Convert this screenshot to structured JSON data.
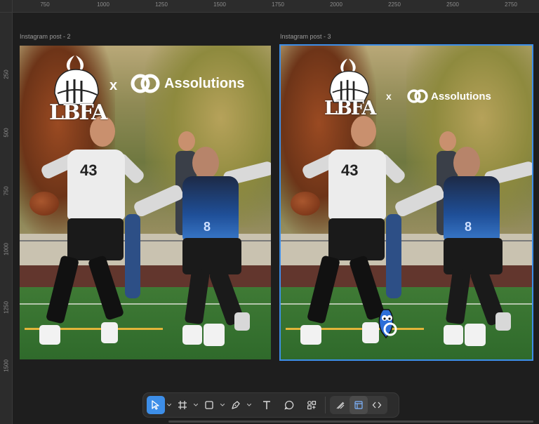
{
  "ruler": {
    "top_ticks": [
      "750",
      "1000",
      "1250",
      "1500",
      "1750",
      "2000",
      "2250",
      "2500",
      "2750"
    ],
    "left_ticks": [
      "250",
      "500",
      "750",
      "1000",
      "1250",
      "1500"
    ]
  },
  "frames": [
    {
      "label": "Instagram post - 2",
      "jersey_number": "43",
      "back_number": "8",
      "logo_text": "LBFA",
      "x_mark": "x",
      "brand": "Assolutions",
      "selected": false
    },
    {
      "label": "Instagram post - 3",
      "jersey_number": "43",
      "back_number": "8",
      "logo_text": "LBFA",
      "x_mark": "x",
      "brand": "Assolutions",
      "selected": true
    }
  ],
  "toolbar": {
    "tools": [
      {
        "name": "move-tool",
        "icon": "cursor-arrow-icon",
        "active": true,
        "has_caret": true
      },
      {
        "name": "frame-tool",
        "icon": "frame-hash-icon",
        "active": false,
        "has_caret": true
      },
      {
        "name": "shape-tool",
        "icon": "rectangle-icon",
        "active": false,
        "has_caret": true
      },
      {
        "name": "pen-tool",
        "icon": "pen-icon",
        "active": false,
        "has_caret": true
      },
      {
        "name": "text-tool",
        "icon": "text-icon",
        "active": false,
        "has_caret": false
      },
      {
        "name": "comment-tool",
        "icon": "comment-bubble-icon",
        "active": false,
        "has_caret": false
      },
      {
        "name": "actions-tool",
        "icon": "components-icon",
        "active": false,
        "has_caret": false
      }
    ],
    "mode_tools": [
      {
        "name": "draw-mode",
        "icon": "pencil-lines-icon",
        "on": false
      },
      {
        "name": "design-mode",
        "icon": "design-grid-icon",
        "on": true
      },
      {
        "name": "dev-mode",
        "icon": "code-brackets-icon",
        "on": false
      }
    ],
    "colors": {
      "accent": "#3d8ee8",
      "background": "#2c2c2c"
    }
  },
  "colors": {
    "canvas": "#1e1e1e",
    "selection": "#3d8ee8",
    "jersey_blue": "#1f4f98"
  }
}
